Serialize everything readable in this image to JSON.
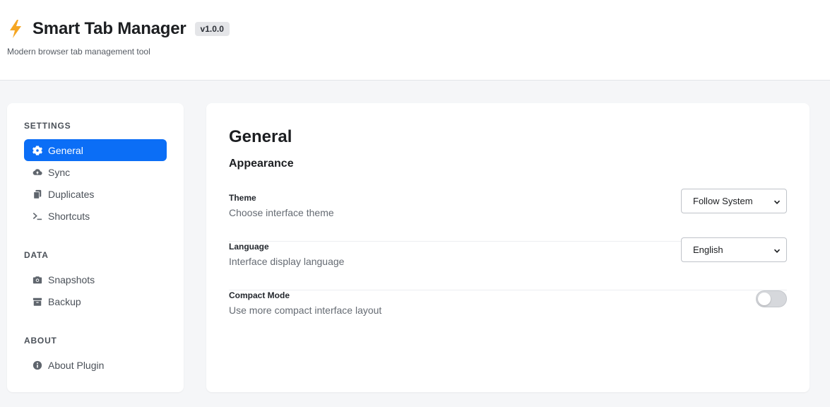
{
  "header": {
    "icon": "lightning-bolt-icon",
    "title": "Smart Tab Manager",
    "version": "v1.0.0",
    "subtitle": "Modern browser tab management tool"
  },
  "sidebar": {
    "sections": [
      {
        "label": "SETTINGS",
        "items": [
          {
            "label": "General",
            "icon": "gear-icon",
            "active": true
          },
          {
            "label": "Sync",
            "icon": "cloud-icon"
          },
          {
            "label": "Duplicates",
            "icon": "copy-icon"
          },
          {
            "label": "Shortcuts",
            "icon": "terminal-icon"
          }
        ]
      },
      {
        "label": "DATA",
        "items": [
          {
            "label": "Snapshots",
            "icon": "camera-icon"
          },
          {
            "label": "Backup",
            "icon": "archive-icon"
          }
        ]
      },
      {
        "label": "ABOUT",
        "items": [
          {
            "label": "About Plugin",
            "icon": "info-icon"
          }
        ]
      }
    ]
  },
  "main": {
    "title": "General",
    "group": "Appearance",
    "settings": [
      {
        "label": "Theme",
        "description": "Choose interface theme",
        "control": "select",
        "value": "Follow System"
      },
      {
        "label": "Language",
        "description": "Interface display language",
        "control": "select",
        "value": "English"
      },
      {
        "label": "Compact Mode",
        "description": "Use more compact interface layout",
        "control": "toggle",
        "value": false
      }
    ]
  },
  "colors": {
    "accent": "#0b6ef6",
    "background": "#f5f6f8",
    "bolt": "#f5a623"
  }
}
